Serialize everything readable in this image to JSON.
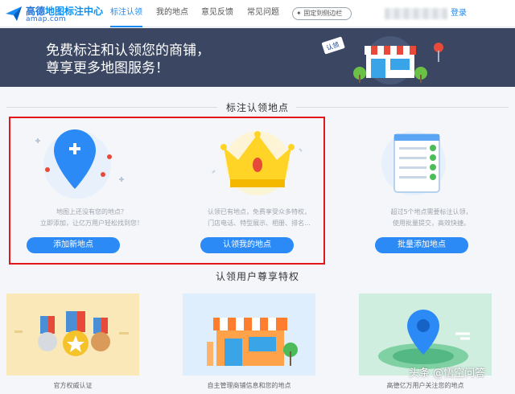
{
  "header": {
    "logo_line1_prefix": "高德",
    "logo_line1_highlight": "地图标注中心",
    "logo_line2": "amap.com",
    "nav": [
      "标注认领",
      "我的地点",
      "意见反馈",
      "常见问题"
    ],
    "pin_sidebar": "固定到侧边栏",
    "login": "登录"
  },
  "banner": {
    "line1": "免费标注和认领您的商铺，",
    "line2": "尊享更多地图服务！",
    "sign": "认领"
  },
  "section1": {
    "title": "标注认领地点"
  },
  "cards": [
    {
      "desc1": "地图上还没有您的地点？",
      "desc2": "立即添加，让亿万用户轻松找到您！",
      "button": "添加新地点"
    },
    {
      "desc1": "认领已有地点，免费享受众多特权，",
      "desc2": "门店电话、特型展示、相册、排名...",
      "button": "认领我的地点"
    },
    {
      "desc1": "超过5个地点需要标注认领，",
      "desc2": "使用批量提交，高效快捷。",
      "button": "批量添加地点"
    }
  ],
  "section2": {
    "title": "认领用户尊享特权"
  },
  "perks": [
    {
      "label": "官方权威认证"
    },
    {
      "label": "自主管理商铺信息和您的地点"
    },
    {
      "label": "高德亿万用户关注您的地点"
    }
  ],
  "watermark": "头条 @悟空问答",
  "colors": {
    "accent": "#2b8af5",
    "banner": "#3a4662",
    "highlight_box": "#e3161c"
  }
}
